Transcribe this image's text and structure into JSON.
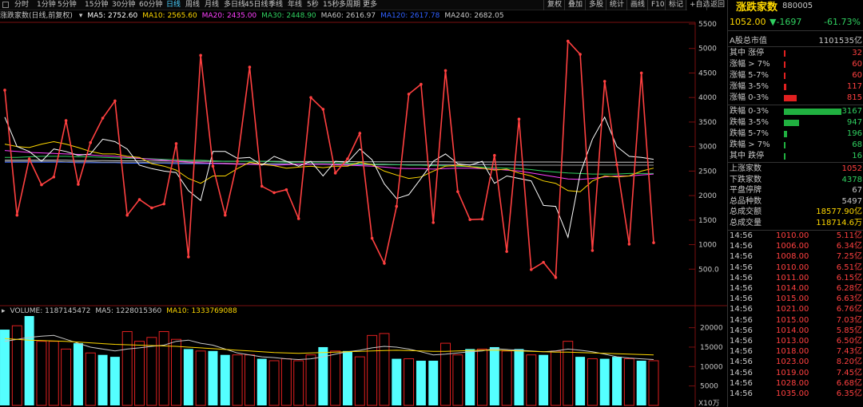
{
  "toolbar": {
    "periods": [
      "分时",
      "1分钟",
      "5分钟",
      "15分钟",
      "30分钟",
      "60分钟",
      "日线",
      "周线",
      "月线",
      "多日线",
      "45日线",
      "季线",
      "年线",
      "5秒",
      "15秒",
      "多周期",
      "更多"
    ],
    "active": "日线",
    "right_buttons": [
      "复权",
      "叠加",
      "多股",
      "统计",
      "画线",
      "F10",
      "+自选",
      "返回"
    ],
    "mark_btn": "标记"
  },
  "ma_legend": {
    "name": "涨跌家数(日线,前复权)",
    "items": [
      {
        "label": "MA5: 2752.60",
        "color": "#ffffff"
      },
      {
        "label": "MA10: 2565.60",
        "color": "#ffd800"
      },
      {
        "label": "MA20: 2435.00",
        "color": "#ff40ff"
      },
      {
        "label": "MA30: 2448.90",
        "color": "#30d060"
      },
      {
        "label": "MA60: 2616.97",
        "color": "#c8c8c8"
      },
      {
        "label": "MA120: 2617.78",
        "color": "#3060ff"
      },
      {
        "label": "MA240: 2682.05",
        "color": "#c8c8c8"
      }
    ]
  },
  "vol_legend": {
    "items": [
      {
        "label": "VOLUME: 1187145472",
        "color": "#c8c8c8"
      },
      {
        "label": "MA5: 1228015360",
        "color": "#c8c8c8"
      },
      {
        "label": "MA10: 1333769088",
        "color": "#ffd800"
      }
    ]
  },
  "y_axis": [
    "5500",
    "5000",
    "4500",
    "4000",
    "3500",
    "3000",
    "2500",
    "2000",
    "1500",
    "1000",
    "500.0"
  ],
  "vol_axis": [
    "20000",
    "15000",
    "10000",
    "5000"
  ],
  "vol_unit": "X10万",
  "chart_data": {
    "type": "line",
    "main_series": [
      4150,
      1600,
      2750,
      2220,
      2380,
      3530,
      2230,
      3080,
      3580,
      3930,
      1600,
      1920,
      1750,
      1830,
      3060,
      750,
      4860,
      2600,
      1600,
      2700,
      4620,
      2190,
      2060,
      2120,
      1530,
      4000,
      3760,
      2460,
      2750,
      3270,
      1130,
      620,
      1780,
      4070,
      4270,
      1450,
      4550,
      2080,
      1510,
      1520,
      2820,
      860,
      3560,
      490,
      640,
      330,
      5150,
      4880,
      880,
      4330,
      2630,
      1010,
      4500,
      1040
    ],
    "ma5": [
      3600,
      3000,
      2900,
      2700,
      2950,
      2900,
      2820,
      2850,
      3150,
      3100,
      2950,
      2620,
      2550,
      2500,
      2470,
      2100,
      1900,
      2900,
      2900,
      2760,
      2780,
      2620,
      2800,
      2700,
      2600,
      2700,
      2400,
      2700,
      2680,
      2950,
      2730,
      2240,
      1940,
      2020,
      2350,
      2700,
      2850,
      2650,
      2620,
      2700,
      2250,
      2400,
      2350,
      2300,
      1800,
      1780,
      1150,
      2450,
      3150,
      3600,
      3000,
      2800,
      2780,
      2740
    ],
    "ma10": [
      3050,
      3000,
      2980,
      3050,
      3100,
      3050,
      2980,
      2900,
      2850,
      2850,
      2800,
      2780,
      2650,
      2600,
      2520,
      2350,
      2250,
      2400,
      2400,
      2550,
      2680,
      2640,
      2610,
      2560,
      2580,
      2600,
      2570,
      2600,
      2600,
      2680,
      2630,
      2500,
      2420,
      2350,
      2380,
      2500,
      2600,
      2620,
      2590,
      2560,
      2520,
      2540,
      2460,
      2400,
      2300,
      2250,
      2100,
      2080,
      2300,
      2400,
      2380,
      2400,
      2500,
      2560
    ],
    "ma20": [
      2920,
      2900,
      2880,
      2870,
      2860,
      2850,
      2840,
      2830,
      2810,
      2800,
      2780,
      2760,
      2740,
      2720,
      2700,
      2680,
      2670,
      2660,
      2650,
      2640,
      2640,
      2630,
      2620,
      2630,
      2640,
      2640,
      2640,
      2630,
      2620,
      2610,
      2600,
      2580,
      2560,
      2550,
      2550,
      2540,
      2550,
      2560,
      2560,
      2550,
      2540,
      2520,
      2500,
      2460,
      2420,
      2380,
      2340,
      2330,
      2350,
      2380,
      2400,
      2400,
      2420,
      2440
    ],
    "ma30": [
      2780,
      2780,
      2790,
      2800,
      2800,
      2800,
      2790,
      2790,
      2780,
      2770,
      2760,
      2760,
      2750,
      2740,
      2730,
      2720,
      2720,
      2710,
      2700,
      2700,
      2700,
      2700,
      2690,
      2680,
      2680,
      2670,
      2670,
      2670,
      2660,
      2650,
      2640,
      2640,
      2630,
      2620,
      2620,
      2610,
      2610,
      2600,
      2590,
      2580,
      2570,
      2560,
      2550,
      2530,
      2500,
      2480,
      2460,
      2450,
      2440,
      2440,
      2440,
      2450,
      2450,
      2450
    ],
    "ma60": [
      2700,
      2700,
      2700,
      2700,
      2700,
      2690,
      2690,
      2690,
      2680,
      2680,
      2680,
      2680,
      2670,
      2670,
      2670,
      2660,
      2660,
      2660,
      2660,
      2650,
      2650,
      2650,
      2650,
      2650,
      2640,
      2640,
      2640,
      2640,
      2640,
      2640,
      2630,
      2630,
      2630,
      2630,
      2630,
      2630,
      2630,
      2630,
      2630,
      2630,
      2630,
      2630,
      2620,
      2620,
      2620,
      2620,
      2620,
      2620,
      2620,
      2620,
      2620,
      2620,
      2620,
      2620
    ],
    "ma120": [
      2680,
      2680,
      2680,
      2680,
      2680,
      2680,
      2670,
      2670,
      2670,
      2670,
      2660,
      2660,
      2660,
      2660,
      2650,
      2650,
      2650,
      2650,
      2650,
      2650,
      2640,
      2640,
      2640,
      2640,
      2640,
      2640,
      2640,
      2640,
      2630,
      2630,
      2630,
      2630,
      2630,
      2630,
      2630,
      2630,
      2630,
      2630,
      2630,
      2630,
      2630,
      2630,
      2630,
      2620,
      2620,
      2620,
      2620,
      2620,
      2620,
      2620,
      2620,
      2620,
      2620,
      2620
    ],
    "ma240": [
      2720,
      2720,
      2720,
      2720,
      2720,
      2720,
      2715,
      2715,
      2715,
      2710,
      2710,
      2710,
      2705,
      2705,
      2705,
      2700,
      2700,
      2700,
      2700,
      2700,
      2700,
      2700,
      2700,
      2695,
      2695,
      2695,
      2695,
      2695,
      2695,
      2690,
      2690,
      2690,
      2690,
      2690,
      2690,
      2690,
      2690,
      2685,
      2685,
      2685,
      2685,
      2685,
      2685,
      2685,
      2685,
      2685,
      2682,
      2682,
      2682,
      2682,
      2682,
      2682,
      2682,
      2682
    ],
    "volume": [
      19500,
      20500,
      23000,
      16500,
      16500,
      14500,
      16000,
      13500,
      13000,
      12500,
      19000,
      16500,
      17500,
      19000,
      17000,
      14500,
      14000,
      14000,
      13000,
      13000,
      13000,
      12000,
      11500,
      12000,
      11500,
      13000,
      15000,
      14000,
      14000,
      12500,
      18000,
      18500,
      12000,
      12000,
      11500,
      11500,
      16000,
      13000,
      14500,
      14500,
      15000,
      14000,
      14500,
      13000,
      13000,
      14000,
      16500,
      12500,
      12000,
      12000,
      12500,
      12000,
      11500,
      11500
    ],
    "vol_up": [
      false,
      true,
      false,
      true,
      true,
      true,
      false,
      true,
      false,
      false,
      true,
      true,
      true,
      true,
      true,
      false,
      true,
      false,
      false,
      true,
      true,
      false,
      true,
      true,
      true,
      true,
      false,
      true,
      false,
      true,
      true,
      true,
      false,
      true,
      false,
      false,
      true,
      true,
      false,
      true,
      false,
      true,
      false,
      true,
      false,
      true,
      true,
      false,
      true,
      false,
      false,
      true,
      false,
      true
    ],
    "vol_ma10": [
      17200,
      17000,
      16800,
      16700,
      16600,
      16500,
      16300,
      16100,
      15900,
      15700,
      15600,
      15500,
      15400,
      15300,
      15200,
      15000,
      14800,
      14600,
      14400,
      14200,
      14000,
      13800,
      13600,
      13500,
      13400,
      13500,
      13600,
      13700,
      13800,
      13900,
      14000,
      14100,
      14200,
      14100,
      14000,
      13900,
      13900,
      14000,
      14100,
      14200,
      14200,
      14100,
      14000,
      13900,
      13800,
      13700,
      13700,
      13600,
      13500,
      13400,
      13300,
      13200,
      13100,
      13000
    ],
    "vol_ma5": [
      16500,
      17000,
      17500,
      17800,
      18000,
      17000,
      16000,
      15000,
      14500,
      14000,
      14500,
      14800,
      15200,
      15500,
      16500,
      16800,
      16000,
      15500,
      14500,
      13500,
      13000,
      12500,
      12300,
      12000,
      11800,
      12000,
      12500,
      13200,
      13800,
      14200,
      14800,
      15200,
      15000,
      14500,
      13800,
      13000,
      13200,
      13500,
      13800,
      14000,
      14600,
      14400,
      14200,
      14000,
      13800,
      14000,
      14500,
      14200,
      13800,
      13200,
      12500,
      12200,
      12000,
      11800
    ]
  },
  "panel": {
    "title": "涨跌家数",
    "code": "880005",
    "price": "1052.00",
    "change": "▼-1697",
    "pct": "-61.73%",
    "market_label": "A股总市值",
    "market_value": "1101535亿",
    "up_rows": [
      {
        "label": "其中 涨停",
        "value": "32",
        "bar": 0.01
      },
      {
        "label": "涨幅 > 7%",
        "value": "60",
        "bar": 0.015
      },
      {
        "label": "涨幅 5-7%",
        "value": "60",
        "bar": 0.015
      },
      {
        "label": "涨幅 3-5%",
        "value": "117",
        "bar": 0.04
      },
      {
        "label": "涨幅 0-3%",
        "value": "815",
        "bar": 0.22
      }
    ],
    "down_rows": [
      {
        "label": "跌幅 0-3%",
        "value": "3167",
        "bar": 1.0
      },
      {
        "label": "跌幅 3-5%",
        "value": "947",
        "bar": 0.27
      },
      {
        "label": "跌幅 5-7%",
        "value": "196",
        "bar": 0.05
      },
      {
        "label": "跌幅 > 7%",
        "value": "68",
        "bar": 0.015
      },
      {
        "label": "其中 跌停",
        "value": "16",
        "bar": 0.01
      }
    ],
    "stats": [
      {
        "label": "上涨家数",
        "value": "1052",
        "color": "#ff4040"
      },
      {
        "label": "下跌家数",
        "value": "4378",
        "color": "#30d060"
      },
      {
        "label": "平盘停牌",
        "value": "67",
        "color": "#c8c8c8"
      },
      {
        "label": "总品种数",
        "value": "5497",
        "color": "#c8c8c8"
      },
      {
        "label": "总成交额",
        "value": "18577.90亿",
        "color": "#ffd800"
      },
      {
        "label": "总成交量",
        "value": "118714.6万",
        "color": "#ffd800"
      }
    ],
    "ticks": [
      {
        "time": "14:56",
        "price": "1010.00",
        "amount": "5.11亿"
      },
      {
        "time": "14:56",
        "price": "1006.00",
        "amount": "6.34亿"
      },
      {
        "time": "14:56",
        "price": "1008.00",
        "amount": "7.25亿"
      },
      {
        "time": "14:56",
        "price": "1010.00",
        "amount": "6.51亿"
      },
      {
        "time": "14:56",
        "price": "1011.00",
        "amount": "6.15亿"
      },
      {
        "time": "14:56",
        "price": "1014.00",
        "amount": "6.28亿"
      },
      {
        "time": "14:56",
        "price": "1015.00",
        "amount": "6.63亿"
      },
      {
        "time": "14:56",
        "price": "1021.00",
        "amount": "6.76亿"
      },
      {
        "time": "14:56",
        "price": "1015.00",
        "amount": "7.03亿"
      },
      {
        "time": "14:56",
        "price": "1014.00",
        "amount": "5.85亿"
      },
      {
        "time": "14:56",
        "price": "1013.00",
        "amount": "6.50亿"
      },
      {
        "time": "14:56",
        "price": "1018.00",
        "amount": "7.43亿"
      },
      {
        "time": "14:56",
        "price": "1023.00",
        "amount": "8.20亿"
      },
      {
        "time": "14:56",
        "price": "1019.00",
        "amount": "7.45亿"
      },
      {
        "time": "14:56",
        "price": "1028.00",
        "amount": "6.68亿"
      },
      {
        "time": "14:56",
        "price": "1035.00",
        "amount": "6.35亿"
      }
    ]
  }
}
